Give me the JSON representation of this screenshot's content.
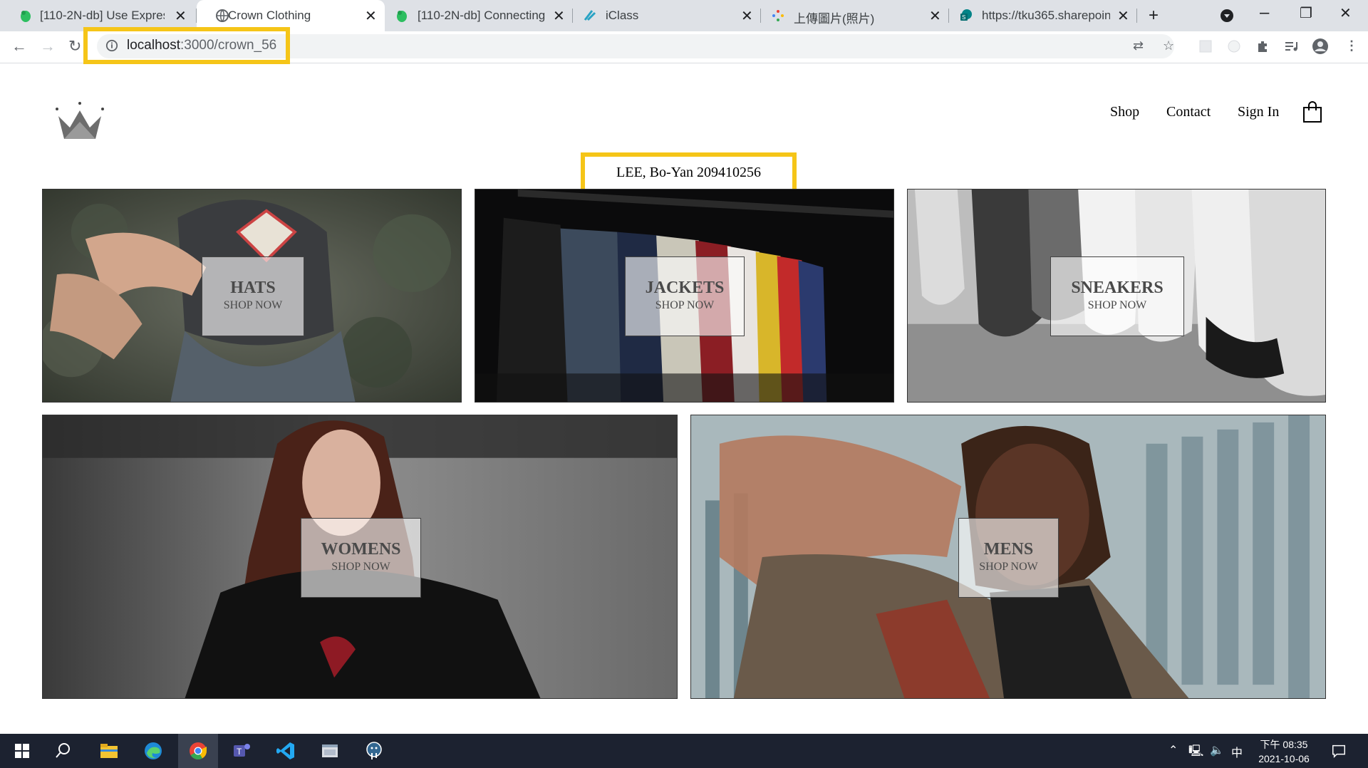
{
  "browser": {
    "tabs": [
      {
        "title": "[110-2N-db] Use Express",
        "icon": "evernote-icon"
      },
      {
        "title": "Crown Clothing",
        "icon": "globe-icon"
      },
      {
        "title": "[110-2N-db] Connecting",
        "icon": "evernote-icon"
      },
      {
        "title": "iClass",
        "icon": "iclass-icon"
      },
      {
        "title": "上傳圖片(照片)",
        "icon": "pinwheel-icon"
      },
      {
        "title": "https://tku365.sharepoint",
        "icon": "sharepoint-icon"
      }
    ],
    "url_host": "localhost",
    "url_path": ":3000/crown_56"
  },
  "header": {
    "nav": [
      "Shop",
      "Contact",
      "Sign In"
    ]
  },
  "student_label": "LEE, Bo-Yan 209410256",
  "directory": [
    {
      "title": "HATS",
      "subtitle": "SHOP NOW"
    },
    {
      "title": "JACKETS",
      "subtitle": "SHOP NOW"
    },
    {
      "title": "SNEAKERS",
      "subtitle": "SHOP NOW"
    },
    {
      "title": "WOMENS",
      "subtitle": "SHOP NOW"
    },
    {
      "title": "MENS",
      "subtitle": "SHOP NOW"
    }
  ],
  "taskbar": {
    "clock_top": "下午 08:35",
    "clock_date": "2021-10-06",
    "ime": "中"
  },
  "colors": {
    "highlight": "#f5c518",
    "taskbar": "#1c2230",
    "tabstrip": "#dee1e6"
  }
}
